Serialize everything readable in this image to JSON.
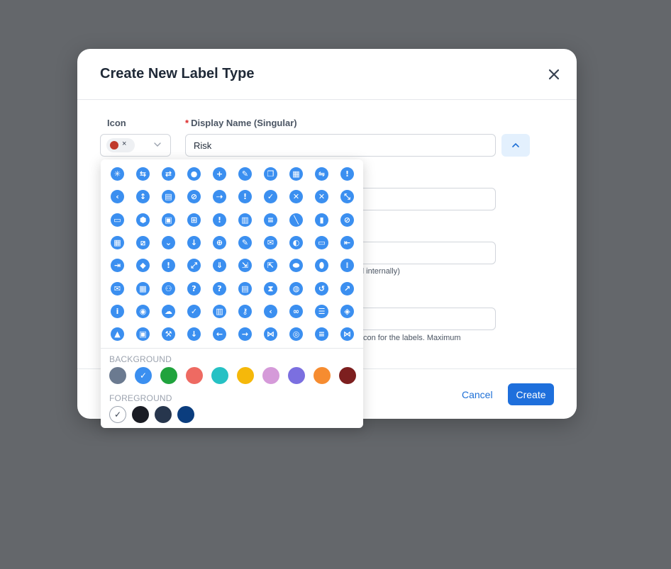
{
  "modal": {
    "title": "Create New Label Type",
    "icon_label": "Icon",
    "display_name_label": "Display Name (Singular)",
    "display_name_required": "*",
    "display_name_value": "Risk",
    "selected_icon_remove": "×",
    "help_text_1": "d internally)",
    "help_text_2": "con for the labels. Maximum",
    "cancel_label": "Cancel",
    "create_label": "Create"
  },
  "picker": {
    "icons": [
      "asterisk-icon",
      "road-icon",
      "signpost-icon",
      "user-circle-icon",
      "plus-icon",
      "user-edit-icon",
      "copy-icon",
      "calculator-icon",
      "toggle-sign-icon",
      "exclamation-icon",
      "chevron-left-icon",
      "arrows-vertical-icon",
      "calendar-icon",
      "ban-icon",
      "arrow-dots-icon",
      "alert-square-icon",
      "check-icon",
      "times-circle-icon",
      "times-icon",
      "compress-icon",
      "comment-icon",
      "stop-icon",
      "columns-icon",
      "sitemap-icon",
      "info-round-icon",
      "grid-icon",
      "database-icon",
      "pencil-line-icon",
      "trash-icon",
      "ban-alt-icon",
      "calculator-grid-icon",
      "slash-icon",
      "chevron-down-icon",
      "arrow-down-icon",
      "copy-plus-icon",
      "pencil-icon",
      "envelope-icon",
      "toggle-icon",
      "laptop-icon",
      "sign-in-icon",
      "sign-out-icon",
      "shield-icon",
      "exclamation-circle-icon",
      "expand-icon",
      "angle-double-down-icon",
      "file-export-icon",
      "external-link-icon",
      "capsules-icon",
      "pills-icon",
      "grip-icon",
      "mail-open-icon",
      "table-icon",
      "users-icon",
      "question-icon",
      "question-circle-icon",
      "clipboard-icon",
      "hourglass-icon",
      "globe-icon",
      "undo-icon",
      "arrow-up-right-icon",
      "info-icon",
      "eye-icon",
      "cloud-icon",
      "check-circle-icon",
      "keyboard-icon",
      "key-icon",
      "chevron-left-alt-icon",
      "link-icon",
      "list-icon",
      "tag-icon",
      "lock-icon",
      "image-icon",
      "wrench-icon",
      "arrow-down-long-icon",
      "arrow-left-icon",
      "arrow-right-icon",
      "share-nodes-icon",
      "globe-alt-icon",
      "bars-icon",
      "bowtie-icon"
    ],
    "glyphs": [
      "✳",
      "⇆",
      "⇄",
      "●",
      "+",
      "✎",
      "❐",
      "▦",
      "⇋",
      "!",
      "‹",
      "↕",
      "▤",
      "⊘",
      "⇢",
      "!",
      "✓",
      "✕",
      "✕",
      "⤡",
      "▭",
      "⬢",
      "▣",
      "⊞",
      "!",
      "▥",
      "≡",
      "╲",
      "▮",
      "⊘",
      "▦",
      "⧄",
      "⌄",
      "↓",
      "⊕",
      "✎",
      "✉",
      "◐",
      "▭",
      "⇤",
      "⇥",
      "◆",
      "!",
      "⤢",
      "⇓",
      "⇲",
      "⇱",
      "⬬",
      "⬮",
      "⁞",
      "✉",
      "▦",
      "⚇",
      "?",
      "?",
      "▤",
      "⧗",
      "◍",
      "↺",
      "↗",
      "i",
      "◉",
      "☁",
      "✓",
      "▥",
      "⚷",
      "‹",
      "∞",
      "☰",
      "◈",
      "▲",
      "▣",
      "⚒",
      "↓",
      "←",
      "→",
      "⋈",
      "◎",
      "≡",
      "⋈"
    ],
    "background_label": "BACKGROUND",
    "foreground_label": "FOREGROUND",
    "background_colors": [
      "#6b7a90",
      "#3b8ff0",
      "#20a33d",
      "#ee6a62",
      "#26c1c4",
      "#f5b80a",
      "#d59ad9",
      "#7b6fe0",
      "#f68c30",
      "#7d1f1f"
    ],
    "background_selected": 1,
    "foreground_colors": [
      "#ffffff",
      "#1a1c24",
      "#27364d",
      "#0b3d7e"
    ],
    "foreground_selected": 0,
    "check_mark": "✓"
  }
}
